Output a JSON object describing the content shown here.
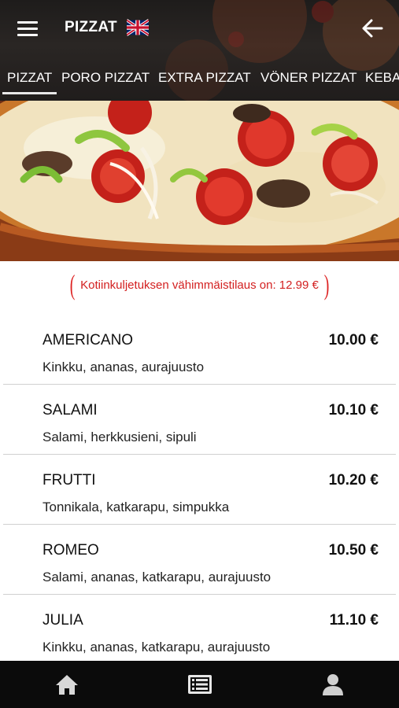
{
  "header": {
    "title": "PIZZAT",
    "menu_icon": "hamburger-menu-icon",
    "language_icon": "uk-flag-icon",
    "back_icon": "arrow-left-icon"
  },
  "tabs": [
    {
      "label": "PIZZAT",
      "active": true
    },
    {
      "label": "PORO PIZZAT",
      "active": false
    },
    {
      "label": "EXTRA PIZZAT",
      "active": false
    },
    {
      "label": "VÖNER PIZZAT",
      "active": false
    },
    {
      "label": "KEBA",
      "active": false
    }
  ],
  "notice": {
    "min_order_text": "Kotiinkuljetuksen vähimmäistilaus on: 12.99 €",
    "left_paren": "(",
    "right_paren": ")"
  },
  "menu_items": [
    {
      "name": "AMERICANO",
      "price": "10.00 €",
      "description": "Kinkku, ananas, aurajuusto"
    },
    {
      "name": "SALAMI",
      "price": "10.10 €",
      "description": "Salami, herkkusieni, sipuli"
    },
    {
      "name": "FRUTTI",
      "price": "10.20 €",
      "description": "Tonnikala, katkarapu, simpukka"
    },
    {
      "name": "ROMEO",
      "price": "10.50 €",
      "description": "Salami, ananas, katkarapu, aurajuusto"
    },
    {
      "name": "JULIA",
      "price": "11.10 €",
      "description": "Kinkku, ananas, katkarapu, aurajuusto"
    }
  ],
  "bottom_nav": [
    {
      "icon": "home-icon"
    },
    {
      "icon": "menu-list-icon"
    },
    {
      "icon": "user-icon"
    }
  ],
  "colors": {
    "accent_red": "#d32020",
    "bar_dark": "#0b0b0b",
    "header_dark": "#221f1e"
  }
}
